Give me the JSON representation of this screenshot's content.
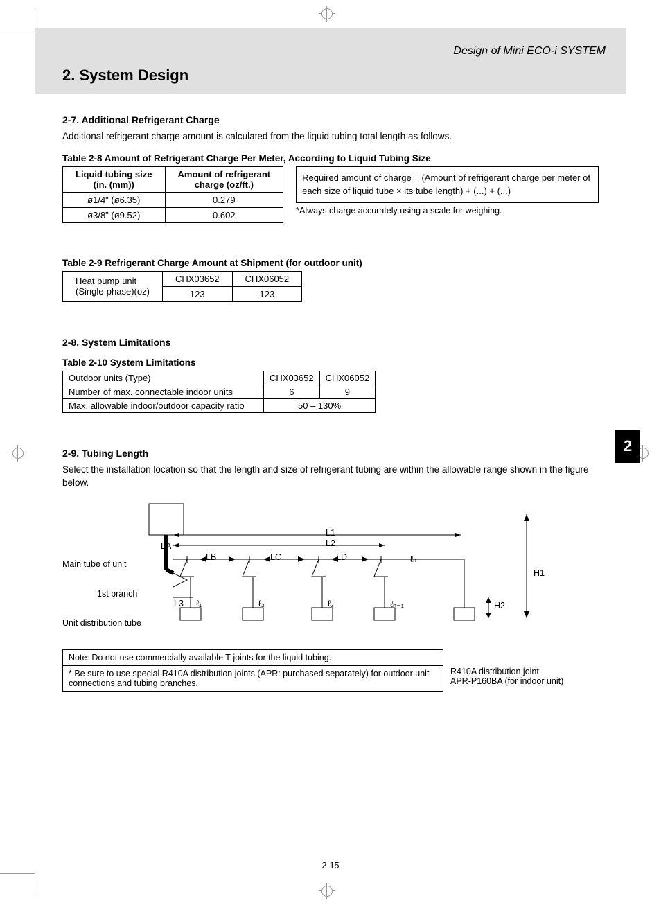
{
  "header": {
    "running": "Design of Mini ECO-i SYSTEM",
    "title": "2. System Design"
  },
  "tab_number": "2",
  "page_number": "2-15",
  "section_2_7": {
    "heading": "2-7.  Additional Refrigerant Charge",
    "intro": "Additional refrigerant charge amount is calculated from the liquid tubing total length as follows.",
    "table_caption": "Table 2-8  Amount of Refrigerant Charge Per Meter, According to Liquid Tubing Size",
    "table_headers": {
      "c1_line1": "Liquid tubing size",
      "c1_line2": "(in. (mm))",
      "c2_line1": "Amount of refrigerant",
      "c2_line2": "charge (oz/ft.)"
    },
    "table_rows": [
      {
        "size": "ø1/4\" (ø6.35)",
        "amount": "0.279"
      },
      {
        "size": "ø3/8\" (ø9.52)",
        "amount": "0.602"
      }
    ],
    "formula": "Required amount of charge = (Amount of refrigerant charge per meter of each size of liquid tube × its tube length) + (...) + (...)",
    "formula_note": "*Always charge accurately using a scale for weighing."
  },
  "table_2_9": {
    "caption": "Table 2-9  Refrigerant Charge Amount at Shipment (for outdoor unit)",
    "row_label": "Heat pump unit",
    "row2_label": "(Single-phase)(oz)",
    "col1": "CHX03652",
    "col2": "CHX06052",
    "val1": "123",
    "val2": "123"
  },
  "section_2_8": {
    "heading": "2-8.  System Limitations",
    "table_caption": "Table 2-10  System Limitations",
    "rows": {
      "r1_label": "Outdoor units (Type)",
      "r1_v1": "CHX03652",
      "r1_v2": "CHX06052",
      "r2_label": "Number of max. connectable indoor units",
      "r2_v1": "6",
      "r2_v2": "9",
      "r3_label": "Max. allowable indoor/outdoor capacity ratio",
      "r3_v": "50  – 130%"
    }
  },
  "section_2_9": {
    "heading": "2-9.  Tubing Length",
    "intro": "Select the installation location so that the length and size of refrigerant tubing are within the allowable range shown in the figure below.",
    "diagram_labels": {
      "main_tube": "Main tube of unit",
      "first_branch": "1st branch",
      "unit_dist": "Unit distribution tube",
      "LA": "LA",
      "LB": "LB",
      "LC": "LC",
      "LD": "LD",
      "L1": "L1",
      "L2": "L2",
      "L3": "L3",
      "l1": "ℓ₁",
      "l2": "ℓ₂",
      "l3": "ℓ₃",
      "ln1": "ℓₙ₋₁",
      "ln": "ℓₙ",
      "H1": "H1",
      "H2": "H2"
    },
    "note_box": {
      "n1": "Note: Do not use commercially available T-joints for the liquid tubing.",
      "n2": "* Be sure to use special R410A distribution joints (APR: purchased separately) for outdoor unit connections and tubing branches."
    },
    "side_note_l1": "R410A distribution joint",
    "side_note_l2": "APR-P160BA (for indoor unit)"
  }
}
